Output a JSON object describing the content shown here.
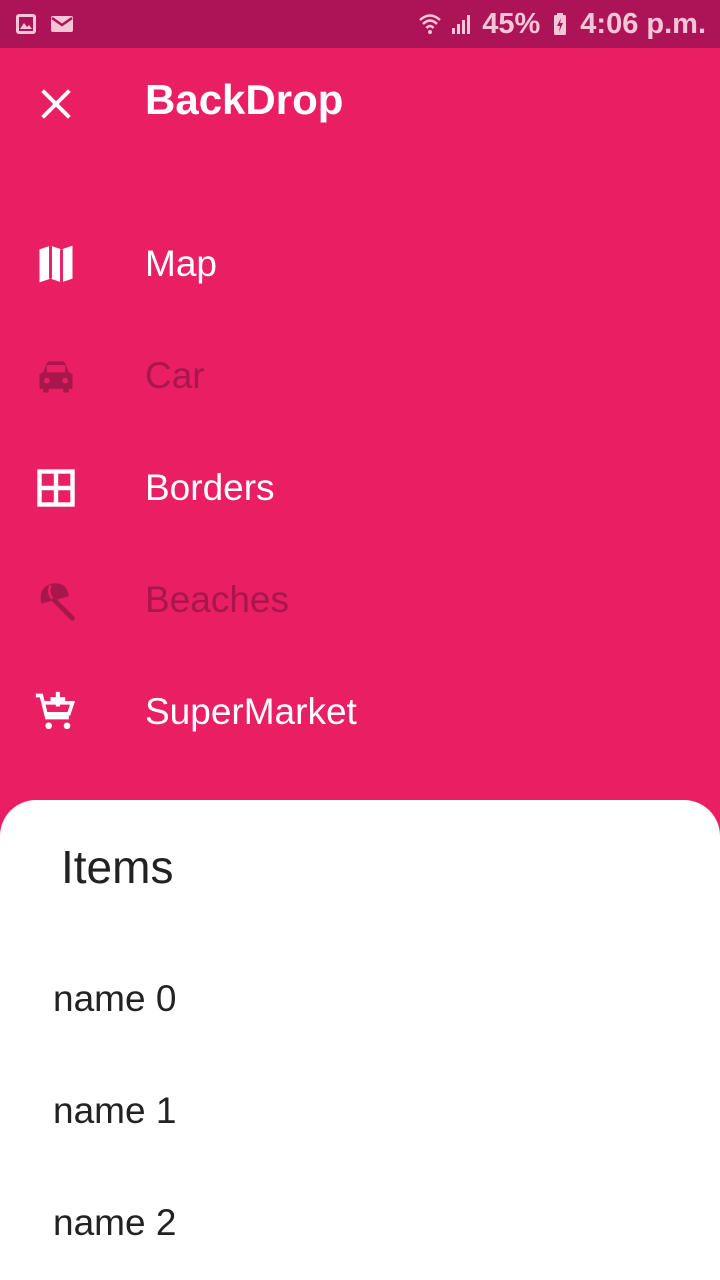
{
  "status_bar": {
    "icons": [
      "image-icon",
      "mail-icon",
      "wifi-icon",
      "signal-icon",
      "battery-charging-icon"
    ],
    "battery": "45%",
    "time": "4:06 p.m."
  },
  "app_bar": {
    "title": "BackDrop",
    "close_icon": "close-icon"
  },
  "menu": {
    "items": [
      {
        "label": "Map",
        "icon": "map-icon",
        "active": true
      },
      {
        "label": "Car",
        "icon": "car-icon",
        "active": false
      },
      {
        "label": "Borders",
        "icon": "border-all-icon",
        "active": true
      },
      {
        "label": "Beaches",
        "icon": "beach-umbrella-icon",
        "active": false
      },
      {
        "label": "SuperMarket",
        "icon": "add-shopping-cart-icon",
        "active": true
      }
    ]
  },
  "sheet": {
    "title": "Items",
    "items": [
      "name 0",
      "name 1",
      "name 2"
    ]
  },
  "colors": {
    "primary": "#E91E63",
    "status_bar": "#AD1457",
    "disabled_text": "#A8174B",
    "sheet_bg": "#FFFFFF"
  }
}
